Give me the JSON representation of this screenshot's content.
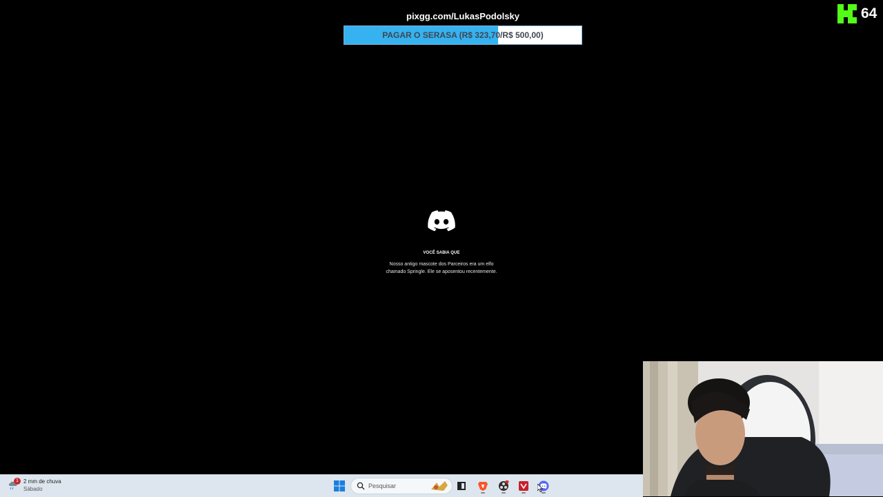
{
  "overlay": {
    "donation_url": "pixgg.com/LukasPodolsky",
    "goal_text": "PAGAR O SERASA (R$ 323,70/R$ 500,00)",
    "goal_current": 323.7,
    "goal_target": 500.0,
    "goal_fill_color": "#35b2ef"
  },
  "kick": {
    "brand_color": "#53fc18",
    "viewer_count": "64"
  },
  "discord_splash": {
    "icon": "discord-icon",
    "tip_heading": "VOCÊ SABIA QUE",
    "tip_body": "Nosso antigo mascote dos Parceiros era um elfo chamado Springle. Ele se aposentou recentemente."
  },
  "taskbar": {
    "weather": {
      "title": "2 mm de chuva",
      "day": "Sábado",
      "badge": "1"
    },
    "search_placeholder": "Pesquisar",
    "pinned": [
      "windows-start-icon",
      "search-icon",
      "task-view-icon",
      "brave-browser-icon",
      "obs-icon",
      "app-red-icon",
      "discord-icon"
    ]
  },
  "webcam": {
    "label": "streamer-webcam"
  }
}
